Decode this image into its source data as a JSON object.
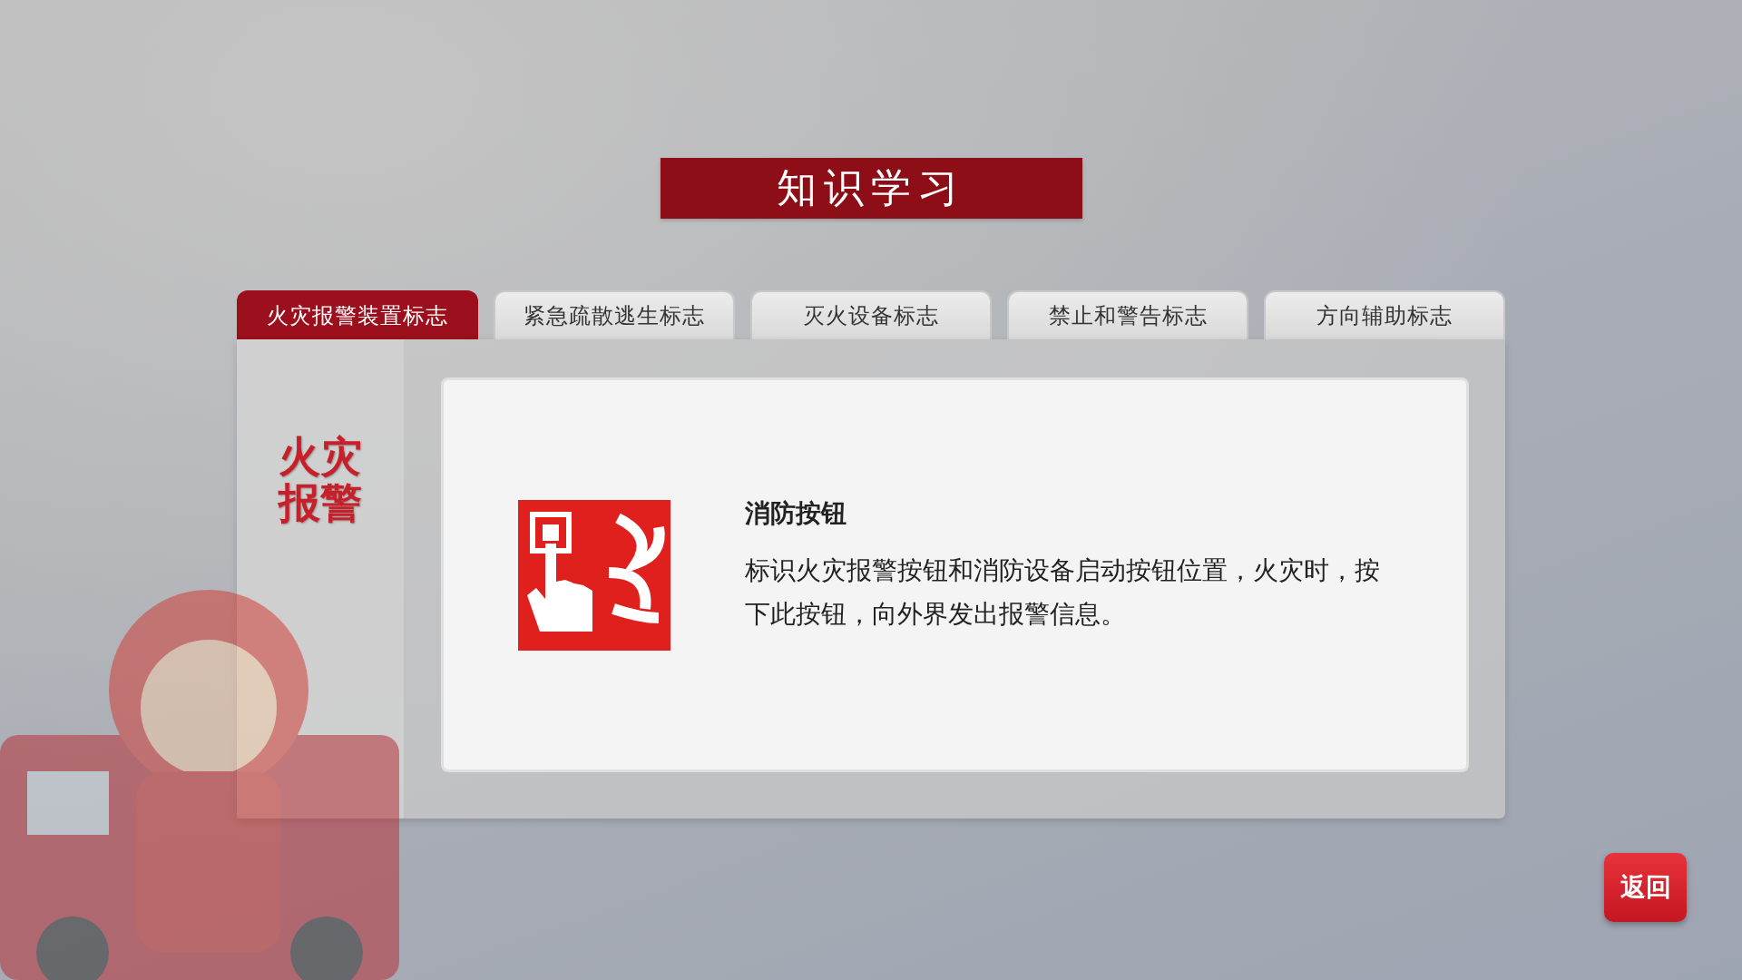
{
  "title": "知识学习",
  "tabs": [
    {
      "label": "火灾报警装置标志",
      "selected": true
    },
    {
      "label": "紧急疏散逃生标志",
      "selected": false
    },
    {
      "label": "灭火设备标志",
      "selected": false
    },
    {
      "label": "禁止和警告标志",
      "selected": false
    },
    {
      "label": "方向辅助标志",
      "selected": false
    }
  ],
  "category_label": "火灾报警",
  "sign": {
    "name": "消防按钮",
    "description": "标识火灾报警按钮和消防设备启动按钮位置，火灾时，按下此按钮，向外界发出报警信息。"
  },
  "back_button": "返回"
}
